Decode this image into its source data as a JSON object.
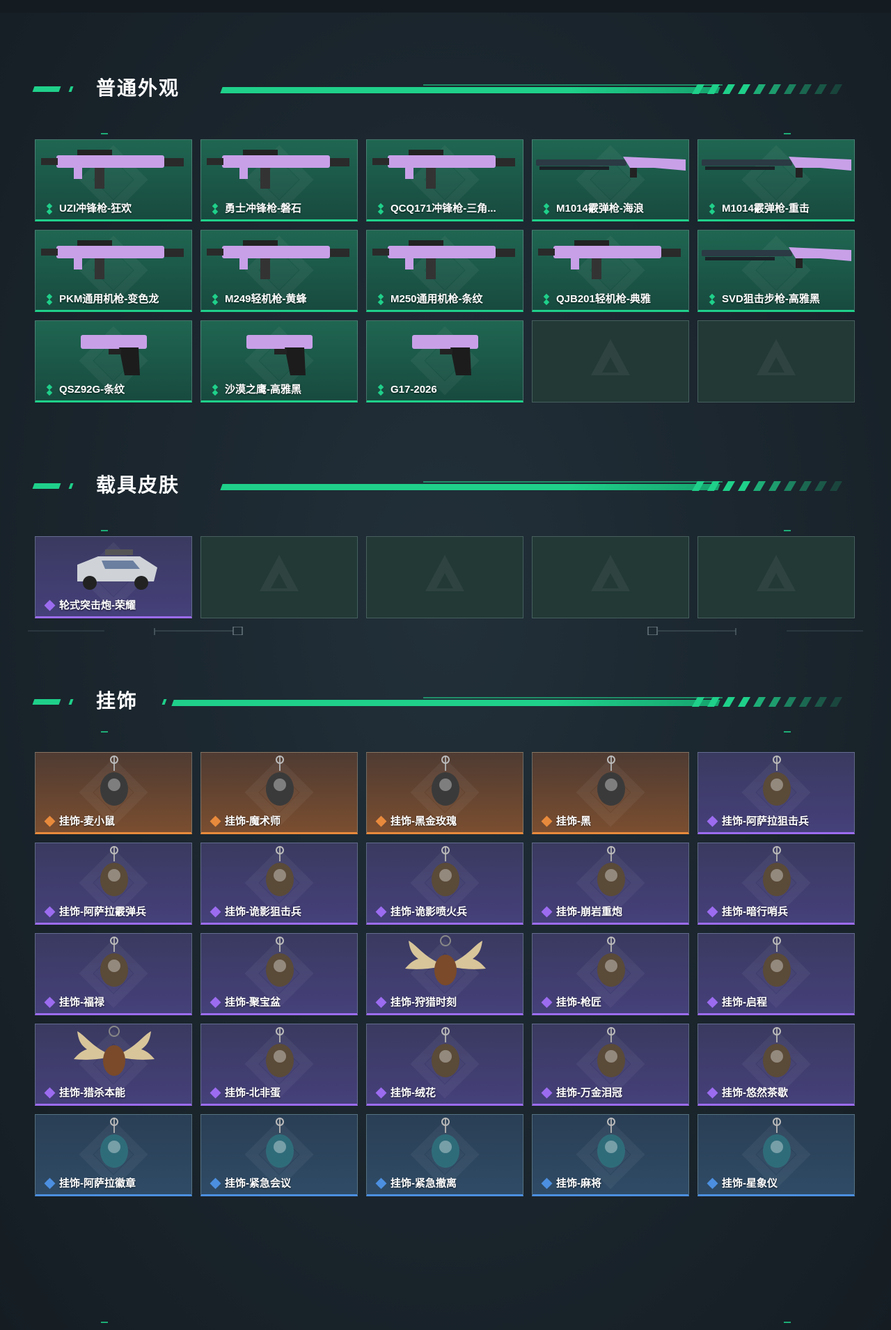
{
  "sections": [
    {
      "title": "普通外观",
      "items": [
        {
          "label": "UZI冲锋枪-狂欢",
          "rarity": "green",
          "icon": "smg-icon"
        },
        {
          "label": "勇士冲锋枪-磐石",
          "rarity": "green",
          "icon": "smg-icon"
        },
        {
          "label": "QCQ171冲锋枪-三角...",
          "rarity": "green",
          "icon": "smg-icon"
        },
        {
          "label": "M1014霰弹枪-海浪",
          "rarity": "green",
          "icon": "shotgun-icon"
        },
        {
          "label": "M1014霰弹枪-重击",
          "rarity": "green",
          "icon": "shotgun-icon"
        },
        {
          "label": "PKM通用机枪-变色龙",
          "rarity": "green",
          "icon": "machine-gun-icon"
        },
        {
          "label": "M249轻机枪-黄蜂",
          "rarity": "green",
          "icon": "machine-gun-icon"
        },
        {
          "label": "M250通用机枪-条纹",
          "rarity": "green",
          "icon": "machine-gun-icon"
        },
        {
          "label": "QJB201轻机枪-典雅",
          "rarity": "green",
          "icon": "machine-gun-icon"
        },
        {
          "label": "SVD狙击步枪-高雅黑",
          "rarity": "green",
          "icon": "sniper-rifle-icon"
        },
        {
          "label": "QSZ92G-条纹",
          "rarity": "green",
          "icon": "pistol-icon"
        },
        {
          "label": "沙漠之鹰-高雅黑",
          "rarity": "green",
          "icon": "pistol-icon"
        },
        {
          "label": "G17-2026",
          "rarity": "green",
          "icon": "pistol-icon"
        },
        {
          "label": "",
          "rarity": "empty",
          "icon": "placeholder-logo-icon"
        },
        {
          "label": "",
          "rarity": "empty",
          "icon": "placeholder-logo-icon"
        }
      ]
    },
    {
      "title": "载具皮肤",
      "items": [
        {
          "label": "轮式突击炮-荣耀",
          "rarity": "purple",
          "icon": "vehicle-icon"
        },
        {
          "label": "",
          "rarity": "empty",
          "icon": "placeholder-logo-icon"
        },
        {
          "label": "",
          "rarity": "empty",
          "icon": "placeholder-logo-icon"
        },
        {
          "label": "",
          "rarity": "empty",
          "icon": "placeholder-logo-icon"
        },
        {
          "label": "",
          "rarity": "empty",
          "icon": "placeholder-logo-icon"
        }
      ]
    },
    {
      "title": "挂饰",
      "items": [
        {
          "label": "挂饰-麦小鼠",
          "rarity": "orange",
          "icon": "charm-icon"
        },
        {
          "label": "挂饰-魔术师",
          "rarity": "orange",
          "icon": "charm-icon"
        },
        {
          "label": "挂饰-黑金玫瑰",
          "rarity": "orange",
          "icon": "charm-icon"
        },
        {
          "label": "挂饰-黑",
          "rarity": "orange",
          "icon": "charm-icon"
        },
        {
          "label": "挂饰-阿萨拉狙击兵",
          "rarity": "purple",
          "icon": "charm-icon"
        },
        {
          "label": "挂饰-阿萨拉霰弹兵",
          "rarity": "purple",
          "icon": "charm-icon"
        },
        {
          "label": "挂饰-诡影狙击兵",
          "rarity": "purple",
          "icon": "charm-icon"
        },
        {
          "label": "挂饰-诡影喷火兵",
          "rarity": "purple",
          "icon": "charm-icon"
        },
        {
          "label": "挂饰-崩岩重炮",
          "rarity": "purple",
          "icon": "charm-icon"
        },
        {
          "label": "挂饰-暗行哨兵",
          "rarity": "purple",
          "icon": "charm-icon"
        },
        {
          "label": "挂饰-福禄",
          "rarity": "purple",
          "icon": "charm-icon"
        },
        {
          "label": "挂饰-聚宝盆",
          "rarity": "purple",
          "icon": "charm-icon"
        },
        {
          "label": "挂饰-狩猎时刻",
          "rarity": "purple",
          "icon": "antler-charm-icon"
        },
        {
          "label": "挂饰-枪匠",
          "rarity": "purple",
          "icon": "charm-icon"
        },
        {
          "label": "挂饰-启程",
          "rarity": "purple",
          "icon": "charm-icon"
        },
        {
          "label": "挂饰-猎杀本能",
          "rarity": "purple",
          "icon": "antler-charm-icon"
        },
        {
          "label": "挂饰-北非蛋",
          "rarity": "purple",
          "icon": "charm-icon"
        },
        {
          "label": "挂饰-绒花",
          "rarity": "purple",
          "icon": "charm-icon"
        },
        {
          "label": "挂饰-万金泪冠",
          "rarity": "purple",
          "icon": "charm-icon"
        },
        {
          "label": "挂饰-悠然茶歇",
          "rarity": "purple",
          "icon": "charm-icon"
        },
        {
          "label": "挂饰-阿萨拉徽章",
          "rarity": "blue",
          "icon": "charm-icon"
        },
        {
          "label": "挂饰-紧急会议",
          "rarity": "blue",
          "icon": "charm-icon"
        },
        {
          "label": "挂饰-紧急撤离",
          "rarity": "blue",
          "icon": "charm-icon"
        },
        {
          "label": "挂饰-麻将",
          "rarity": "blue",
          "icon": "charm-icon"
        },
        {
          "label": "挂饰-星象仪",
          "rarity": "blue",
          "icon": "charm-icon"
        }
      ]
    }
  ],
  "colors": {
    "accent": "#1fd08a",
    "green": "#1fd08a",
    "purple": "#9c6cf0",
    "orange": "#e88a3c",
    "blue": "#4c8fe0"
  }
}
